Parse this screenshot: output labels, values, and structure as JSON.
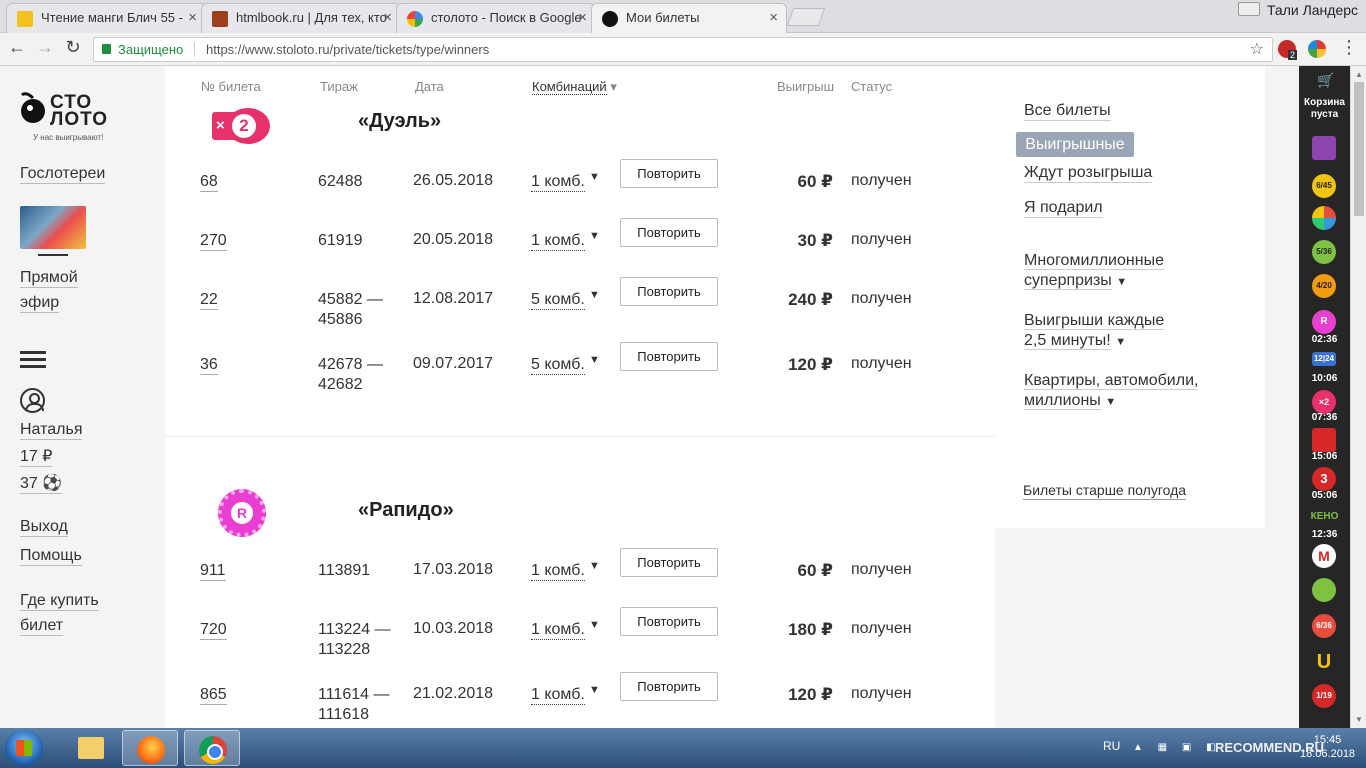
{
  "browser": {
    "tabs": [
      {
        "title": "Чтение манги Блич 55 -"
      },
      {
        "title": "htmlbook.ru | Для тех, кто"
      },
      {
        "title": "столото - Поиск в Google"
      },
      {
        "title": "Мои билеты"
      }
    ],
    "user": "Тали Ландерс",
    "secure_label": "Защищено",
    "url": "https://www.stoloto.ru/private/tickets/type/winners",
    "ext_badge": "2"
  },
  "leftnav": {
    "logo": {
      "line1": "СТО",
      "line2": "ЛОТО",
      "tagline": "У нас выигрывают!"
    },
    "gov_lotteries": "Гослотереи",
    "live": "Прямой",
    "live2": "эфир",
    "user_name": "Наталья",
    "balance": "17 ₽",
    "bonus": "37",
    "logout": "Выход",
    "help": "Помощь",
    "where_buy": "Где купить",
    "where_buy2": "билет"
  },
  "table": {
    "headers": {
      "ticket": "№ билета",
      "draw": "Тираж",
      "date": "Дата",
      "comb": "Комбинаций",
      "prize": "Выигрыш",
      "status": "Статус"
    },
    "repeat_label": "Повторить",
    "games": [
      {
        "title": "«Дуэль»",
        "logo_text": "2",
        "rows": [
          {
            "num": "68",
            "draw": "62488",
            "draw2": "",
            "date": "26.05.2018",
            "comb": "1 комб.",
            "prize": "60 ₽",
            "status": "получен"
          },
          {
            "num": "270",
            "draw": "61919",
            "draw2": "",
            "date": "20.05.2018",
            "comb": "1 комб.",
            "prize": "30 ₽",
            "status": "получен"
          },
          {
            "num": "22",
            "draw": "45882 —",
            "draw2": "45886",
            "date": "12.08.2017",
            "comb": "5 комб.",
            "prize": "240 ₽",
            "status": "получен"
          },
          {
            "num": "36",
            "draw": "42678 —",
            "draw2": "42682",
            "date": "09.07.2017",
            "comb": "5 комб.",
            "prize": "120 ₽",
            "status": "получен"
          }
        ]
      },
      {
        "title": "«Рапидо»",
        "logo_text": "R",
        "rows": [
          {
            "num": "911",
            "draw": "113891",
            "draw2": "",
            "date": "17.03.2018",
            "comb": "1 комб.",
            "prize": "60 ₽",
            "status": "получен"
          },
          {
            "num": "720",
            "draw": "113224 —",
            "draw2": "113228",
            "date": "10.03.2018",
            "comb": "1 комб.",
            "prize": "180 ₽",
            "status": "получен"
          },
          {
            "num": "865",
            "draw": "111614 —",
            "draw2": "111618",
            "date": "21.02.2018",
            "comb": "1 комб.",
            "prize": "120 ₽",
            "status": "получен"
          }
        ]
      }
    ]
  },
  "rightpanel": {
    "all": "Все билеты",
    "winning": "Выигрышные",
    "waiting": "Ждут розыгрыша",
    "gifted": "Я подарил",
    "superprize1": "Многомиллионные",
    "superprize2": "суперпризы",
    "every1": "Выигрыши каждые",
    "every2": "2,5 минуты!",
    "apart1": "Квартиры, автомобили,",
    "apart2": "миллионы",
    "older": "Билеты старше полугода"
  },
  "sidebar": {
    "cart": "Корзина пуста",
    "items": [
      {
        "icon": "lottery-gift-icon",
        "label": "",
        "time": ""
      },
      {
        "icon": "lottery-6-45-icon",
        "label": "6/45",
        "time": ""
      },
      {
        "icon": "lottery-rapido-icon",
        "label": "",
        "time": ""
      },
      {
        "icon": "lottery-5-36-icon",
        "label": "5/36",
        "time": ""
      },
      {
        "icon": "lottery-4-20-icon",
        "label": "4/20",
        "time": ""
      },
      {
        "icon": "lottery-rapido-timer-icon",
        "label": "R",
        "time": "02:36"
      },
      {
        "icon": "lottery-12-24-icon",
        "label": "12|24",
        "time": "10:06"
      },
      {
        "icon": "lottery-duel-icon",
        "label": "×2",
        "time": "07:36"
      },
      {
        "icon": "lottery-top3-icon",
        "label": "",
        "time": "15:06"
      },
      {
        "icon": "lottery-top3-red-icon",
        "label": "3",
        "time": "05:06"
      },
      {
        "icon": "lottery-keno-icon",
        "label": "КЕНО",
        "time": "12:36"
      },
      {
        "icon": "lottery-matchball-icon",
        "label": "M",
        "time": ""
      },
      {
        "icon": "lottery-bingo-icon",
        "label": "",
        "time": ""
      },
      {
        "icon": "lottery-6-36-icon",
        "label": "6/36",
        "time": ""
      },
      {
        "icon": "lottery-horseshoe-icon",
        "label": "U",
        "time": ""
      },
      {
        "icon": "lottery-1-19-icon",
        "label": "1/19",
        "time": ""
      }
    ]
  },
  "taskbar": {
    "lang": "RU",
    "time": "15:45",
    "date": "18.06.2018",
    "watermark": "RECOMMEND.RU"
  },
  "colors": {
    "duel": "#e8306a",
    "rapido": "#e83fd0",
    "active_filter": "#9aa6b8",
    "secure": "#1e8e3e"
  }
}
